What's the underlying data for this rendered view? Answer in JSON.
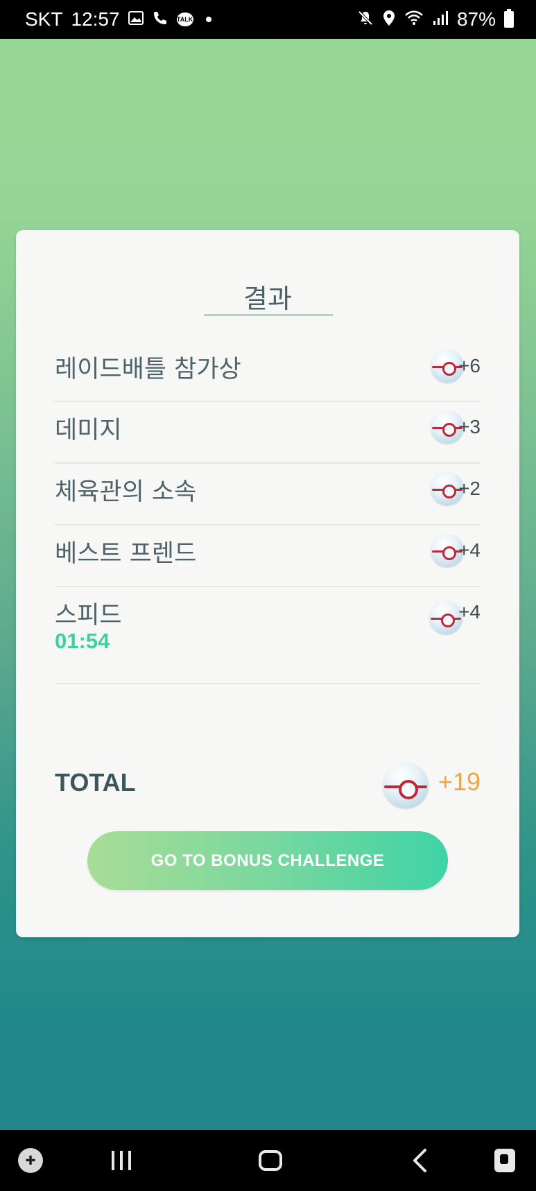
{
  "status_bar": {
    "carrier": "SKT",
    "time": "12:57",
    "talk_badge": "TALK",
    "battery": "87%",
    "icons_left": [
      "image-icon",
      "call-icon",
      "talk-icon",
      "dot-icon"
    ],
    "icons_right": [
      "mute-icon",
      "location-icon",
      "wifi-icon",
      "signal-icon",
      "battery-icon"
    ]
  },
  "results": {
    "title": "결과",
    "rows": [
      {
        "label": "레이드배틀 참가상",
        "value": "+6"
      },
      {
        "label": "데미지",
        "value": "+3"
      },
      {
        "label": "체육관의 소속",
        "value": "+2"
      },
      {
        "label": "베스트 프렌드",
        "value": "+4"
      },
      {
        "label": "스피드",
        "value": "+4",
        "time": "01:54"
      }
    ],
    "total_label": "TOTAL",
    "total_value": "+19",
    "bonus_button": "GO TO BONUS CHALLENGE"
  },
  "colors": {
    "accent_green": "#3ecf9e",
    "total_orange": "#f0a340",
    "card_bg": "#f7f8f6"
  },
  "nav_bar": {
    "icons": [
      "game-launcher-icon",
      "recent-apps-icon",
      "home-icon",
      "back-icon",
      "assistant-icon"
    ]
  }
}
